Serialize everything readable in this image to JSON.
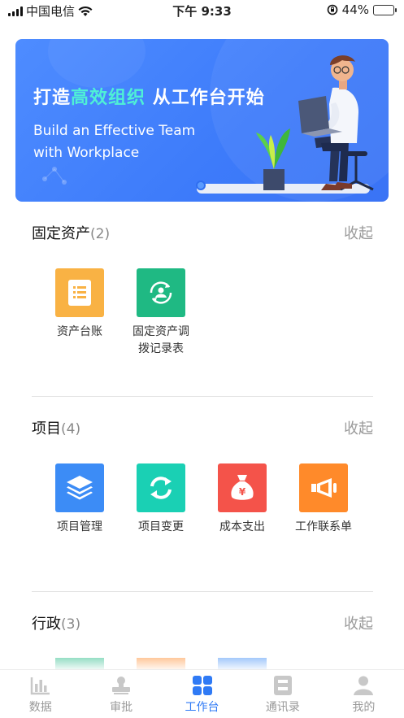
{
  "status_bar": {
    "carrier": "中国电信",
    "time": "下午 9:33",
    "battery": "44%",
    "battery_level": 0.44
  },
  "banner": {
    "title_part1": "打造",
    "title_highlight": "高效组织",
    "title_part2": " 从工作台开始",
    "subtitle_line1": "Build an Effective Team",
    "subtitle_line2": "with Workplace"
  },
  "sections": [
    {
      "title": "固定资产",
      "count": "(2)",
      "collapse_label": "收起",
      "items": [
        {
          "label": "资产台账",
          "icon": "ledger-icon",
          "color": "#f9b244"
        },
        {
          "label_line1": "固定资产调",
          "label_line2": "拨记录表",
          "icon": "transfer-icon",
          "color": "#1fb983"
        }
      ]
    },
    {
      "title": "项目",
      "count": "(4)",
      "collapse_label": "收起",
      "items": [
        {
          "label": "项目管理",
          "icon": "layers-icon",
          "color": "#3c8cf6"
        },
        {
          "label": "项目变更",
          "icon": "refresh-icon",
          "color": "#1ad0b4"
        },
        {
          "label": "成本支出",
          "icon": "money-bag-icon",
          "color": "#f4534a"
        },
        {
          "label": "工作联系单",
          "icon": "megaphone-icon",
          "color": "#ff8a2a"
        }
      ]
    },
    {
      "title": "行政",
      "count": "(3)",
      "collapse_label": "收起",
      "items": [
        {
          "icon": "partial-green",
          "color": "#1fb983"
        },
        {
          "icon": "partial-orange",
          "color": "#ff8a2a"
        },
        {
          "icon": "partial-blue",
          "color": "#3c8cf6"
        }
      ]
    }
  ],
  "tabbar": [
    {
      "label": "数据",
      "icon": "chart-icon",
      "active": false
    },
    {
      "label": "审批",
      "icon": "stamp-icon",
      "active": false
    },
    {
      "label": "工作台",
      "icon": "grid-icon",
      "active": true
    },
    {
      "label": "通讯录",
      "icon": "contacts-icon",
      "active": false
    },
    {
      "label": "我的",
      "icon": "user-icon",
      "active": false
    }
  ],
  "colors": {
    "accent": "#2f7af5",
    "inactive": "#999999"
  }
}
